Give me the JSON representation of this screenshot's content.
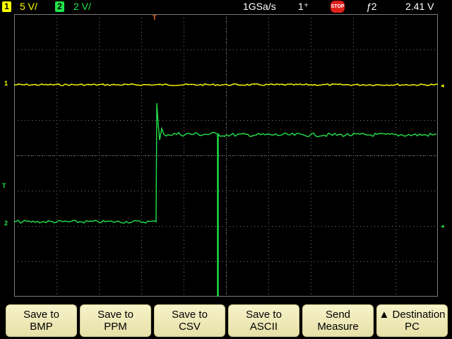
{
  "status": {
    "ch1_number": "1",
    "ch1_scale": "5 V/",
    "ch2_number": "2",
    "ch2_scale": "2 V/",
    "sample_rate": "1GSa/s",
    "acq_mode": "1⁺",
    "run_state": "STOP",
    "trigger_source": "2",
    "trigger_level": "2.41 V"
  },
  "markers": {
    "trigger_top": "T",
    "ch1": "1",
    "ch2": "2",
    "trigger_level": "T"
  },
  "softkeys": [
    {
      "line1": "Save to",
      "line2": "BMP"
    },
    {
      "line1": "Save to",
      "line2": "PPM"
    },
    {
      "line1": "Save to",
      "line2": "CSV"
    },
    {
      "line1": "Save to",
      "line2": "ASCII"
    },
    {
      "line1": "Send",
      "line2": "Measure"
    },
    {
      "line1": "▲ Destination",
      "line2": "PC"
    }
  ],
  "colors": {
    "ch1": "#ffff00",
    "ch2": "#22e34a",
    "trigger": "#ff7722",
    "grid": "#7a7a7a",
    "run_state": "#e0201c"
  },
  "icons": {
    "run_state": "stop-icon",
    "trigger_edge": "rising-edge-trigger-icon"
  }
}
